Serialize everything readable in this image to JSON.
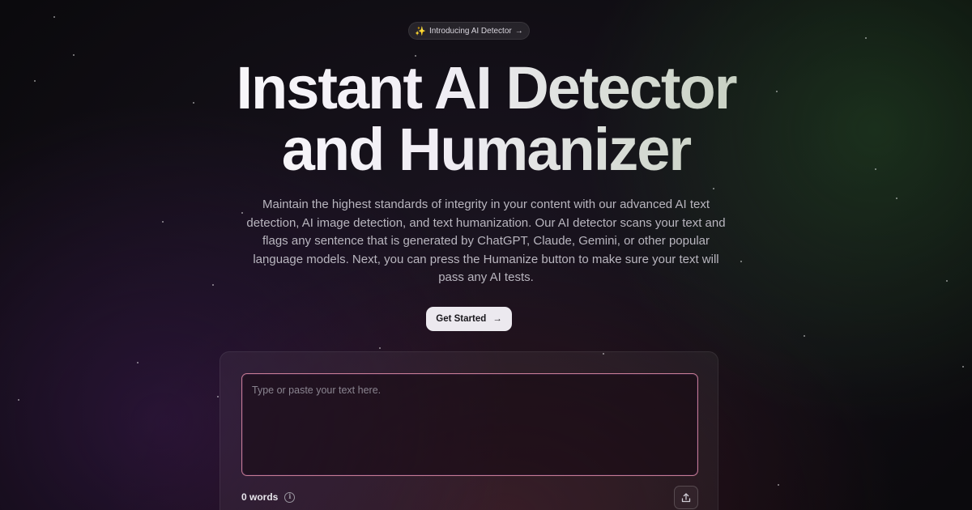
{
  "announcement": {
    "icon": "sparkles-icon",
    "label": "Introducing AI Detector",
    "arrow": "→"
  },
  "hero": {
    "title_line1": "Instant AI Detector",
    "title_line2": "and Humanizer",
    "description": "Maintain the highest standards of integrity in your content with our advanced AI text detection, AI image detection, and text humanization. Our AI detector scans your text and flags any sentence that is generated by ChatGPT, Claude, Gemini, or other popular language models. Next, you can press the Humanize button to make sure your text will pass any AI tests."
  },
  "cta": {
    "label": "Get Started",
    "arrow": "→"
  },
  "editor": {
    "placeholder": "Type or paste your text here.",
    "value": "",
    "word_count_label": "0 words",
    "info_icon": "i",
    "upload_icon": "upload-icon"
  },
  "colors": {
    "editor_border": "#c77c93",
    "button_bg": "#ece9ef",
    "background": "#0b0a0d"
  }
}
